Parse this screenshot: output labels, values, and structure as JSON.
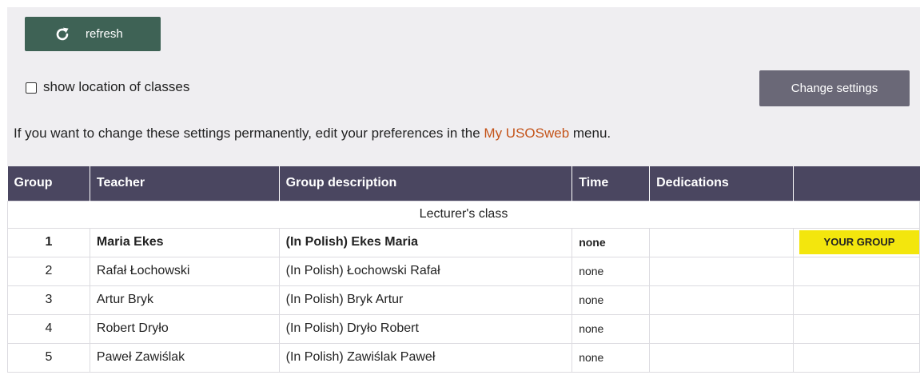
{
  "toolbar": {
    "refresh_label": "refresh",
    "refresh_icon": "refresh-icon",
    "show_location_label": "show location of classes",
    "show_location_checked": false,
    "change_settings_label": "Change settings"
  },
  "info": {
    "text_before": "If you want to change these settings permanently, edit your preferences in the ",
    "link_text": "My USOSweb",
    "text_after": " menu."
  },
  "colors": {
    "panel_bg": "#efeef1",
    "refresh_button": "#3e6255",
    "change_settings_button": "#6a6877",
    "table_header": "#4a4660",
    "link": "#c4541a",
    "your_group_badge": "#f3e60d"
  },
  "table": {
    "headers": [
      "Group",
      "Teacher",
      "Group description",
      "Time",
      "Dedications",
      ""
    ],
    "caption": "Lecturer's class",
    "rows": [
      {
        "group": "1",
        "teacher": "Maria Ekes",
        "description": "(In Polish) Ekes Maria",
        "time": "none",
        "dedications": "",
        "badge": "YOUR GROUP"
      },
      {
        "group": "2",
        "teacher": "Rafał Łochowski",
        "description": "(In Polish) Łochowski Rafał",
        "time": "none",
        "dedications": "",
        "badge": ""
      },
      {
        "group": "3",
        "teacher": "Artur Bryk",
        "description": "(In Polish) Bryk Artur",
        "time": "none",
        "dedications": "",
        "badge": ""
      },
      {
        "group": "4",
        "teacher": "Robert Dryło",
        "description": "(In Polish) Dryło Robert",
        "time": "none",
        "dedications": "",
        "badge": ""
      },
      {
        "group": "5",
        "teacher": "Paweł Zawiślak",
        "description": "(In Polish) Zawiślak Paweł",
        "time": "none",
        "dedications": "",
        "badge": ""
      }
    ]
  }
}
